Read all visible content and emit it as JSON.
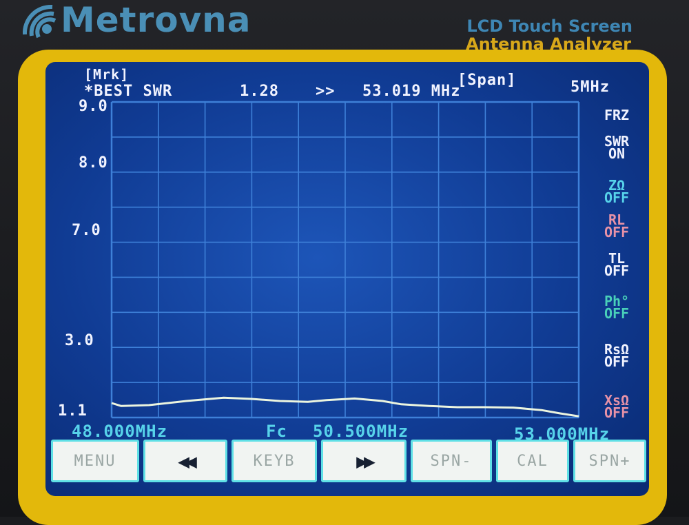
{
  "device": {
    "brand_name": "Metrovna",
    "subtitle_line1": "LCD Touch Screen",
    "subtitle_line2": "Antenna Analyzer"
  },
  "screen": {
    "marker_label": "[Mrk]",
    "best_swr_label": "*BEST SWR",
    "best_swr_value": "1.28",
    "best_arrow": ">>",
    "best_freq": "53.019 MHz",
    "span_label": "[Span]",
    "span_value": "5MHz",
    "y_ticks": [
      "9.0",
      "8.0",
      "7.0",
      "3.0",
      "1.1"
    ],
    "freq_start": "48.000MHz",
    "freq_center_label": "Fc",
    "freq_center": "50.500MHz",
    "freq_end": "53.000MHz",
    "side_controls": [
      {
        "line1": "FRZ",
        "line2": ""
      },
      {
        "line1": "SWR",
        "line2": "ON"
      },
      {
        "line1": "ZΩ",
        "line2": "OFF"
      },
      {
        "line1": "RL",
        "line2": "OFF"
      },
      {
        "line1": "TL",
        "line2": "OFF"
      },
      {
        "line1": "Ph°",
        "line2": "OFF"
      },
      {
        "line1": "RsΩ",
        "line2": "OFF"
      },
      {
        "line1": "XsΩ",
        "line2": "OFF"
      }
    ],
    "buttons": [
      "MENU",
      "◀◀",
      "KEYB",
      "▶▶",
      "SPN-",
      "CAL",
      "SPN+"
    ]
  },
  "colors": {
    "lcd_bg": "#103b93",
    "grid": "#3e80d8",
    "trace": "#ecf5df",
    "accent_cyan": "#57d3ea",
    "bezel": "#e3b80b"
  },
  "chart_data": {
    "type": "line",
    "title": "",
    "xlabel": "",
    "ylabel": "",
    "xlim": [
      48.0,
      53.0
    ],
    "y_tick_labels": [
      "9.0",
      "8.0",
      "7.0",
      "3.0",
      "1.1"
    ],
    "grid": true,
    "series": [
      {
        "x": [
          48.0,
          48.1,
          48.4,
          48.8,
          49.2,
          49.5,
          49.8,
          50.1,
          50.3,
          50.6,
          50.9,
          51.1,
          51.4,
          51.7,
          52.0,
          52.3,
          52.6,
          52.8,
          53.0
        ],
        "y": [
          1.45,
          1.38,
          1.4,
          1.5,
          1.58,
          1.55,
          1.5,
          1.48,
          1.52,
          1.56,
          1.5,
          1.42,
          1.38,
          1.35,
          1.35,
          1.34,
          1.28,
          1.2,
          1.13
        ]
      }
    ]
  }
}
